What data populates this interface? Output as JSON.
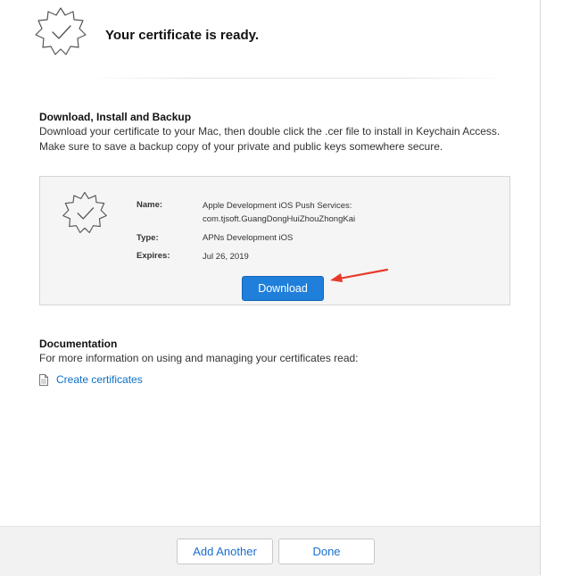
{
  "header": {
    "title": "Your certificate is ready.",
    "icon": "certificate-check-icon"
  },
  "download_section": {
    "heading": "Download, Install and Backup",
    "line1": "Download your certificate to your Mac, then double click the .cer file to install in Keychain Access.",
    "line2": "Make sure to save a backup copy of your private and public keys somewhere secure."
  },
  "certificate": {
    "icon": "certificate-check-icon",
    "name_label": "Name:",
    "name_line1": "Apple Development iOS Push Services:",
    "name_line2": "com.tjsoft.GuangDongHuiZhouZhongKai",
    "type_label": "Type:",
    "type_value": "APNs Development iOS",
    "expires_label": "Expires:",
    "expires_value": "Jul 26, 2019",
    "download_label": "Download"
  },
  "documentation": {
    "heading": "Documentation",
    "text": "For more information on using and managing your certificates read:",
    "link_icon": "document-icon",
    "link_label": "Create certificates"
  },
  "footer": {
    "add_another_label": "Add Another",
    "done_label": "Done"
  },
  "colors": {
    "accent": "#1f7fdb",
    "link": "#0a70c9",
    "annotation_arrow": "#e83a2a"
  }
}
